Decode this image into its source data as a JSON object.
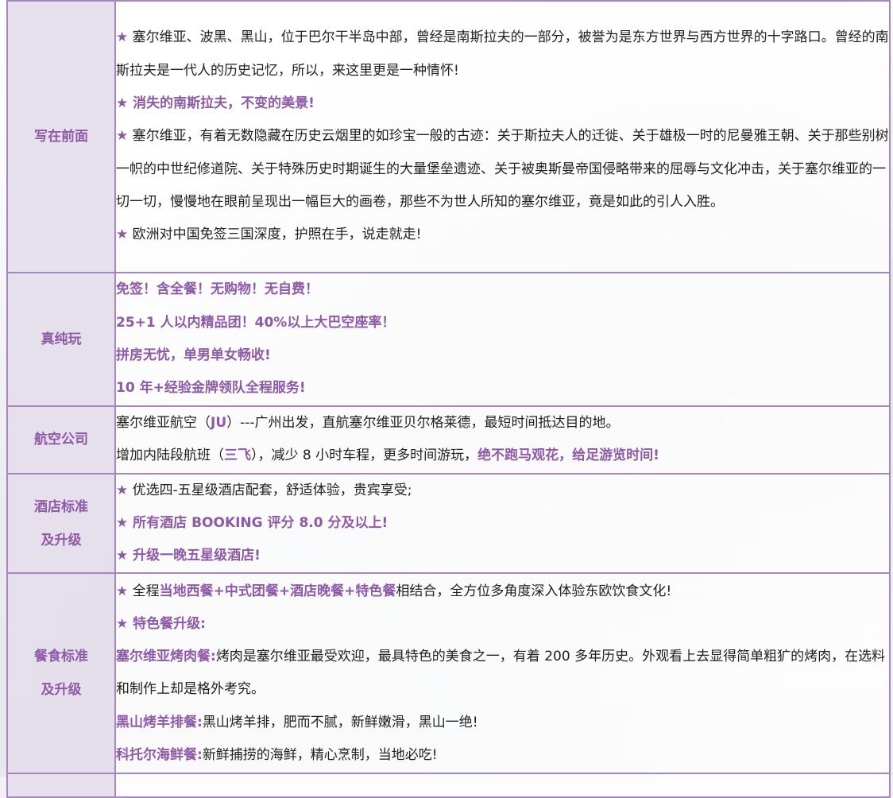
{
  "sections": [
    {
      "label": "写在前面",
      "p1_star": "★",
      "p1": "塞尔维亚、波黑、黑山，位于巴尔干半岛中部，曾经是南斯拉夫的一部分，被誉为是东方世界与西方世界的十字路口。曾经的南斯拉夫是一代人的历史记忆，所以，来这里更是一种情怀!",
      "p2": "★ 消失的南斯拉夫，不变的美景!",
      "p3_star": "★",
      "p3": "塞尔维亚，有着无数隐藏在历史云烟里的如珍宝一般的古迹：关于斯拉夫人的迁徙、关于雄极一时的尼曼雅王朝、关于那些别树一帜的中世纪修道院、关于特殊历史时期诞生的大量堡垒遗迹、关于被奥斯曼帝国侵略带来的屈辱与文化冲击，关于塞尔维亚的一切一切，慢慢地在眼前呈现出一幅巨大的画卷，那些不为世人所知的塞尔维亚，竟是如此的引人入胜。",
      "p4_star": "★",
      "p4": "欧洲对中国免签三国深度，护照在手，说走就走!"
    },
    {
      "label": "真纯玩",
      "lines": [
        "免签！含全餐！无购物！无自费！",
        "25+1 人以内精品团！40%以上大巴空座率！",
        "拼房无忧，单男单女畅收!",
        "10 年+经验金牌领队全程服务!"
      ]
    },
    {
      "label": "航空公司",
      "l1_a": "塞尔维亚航空（",
      "l1_b": "JU",
      "l1_c": "）---广州出发，直航塞尔维亚贝尔格莱德，最短时间抵达目的地。",
      "l2_a": "增加内陆段航班（",
      "l2_b": "三飞",
      "l2_c": "），减少 8 小时车程，更多时间游玩，",
      "l2_d": "绝不跑马观花，给足游览时间!"
    },
    {
      "label1": "酒店标准",
      "label2": "及升级",
      "l1_star": "★",
      "l1": "优选四-五星级酒店配套，舒适体验，贵宾享受;",
      "l2": "★ 所有酒店 BOOKING 评分 8.0 分及以上!",
      "l3": "★ 升级一晚五星级酒店!"
    },
    {
      "label1": "餐食标准",
      "label2": "及升级",
      "l1_star": "★",
      "l1_a": "全程",
      "l1_b": "当地西餐+中式团餐+酒店晚餐+特色餐",
      "l1_c": "相结合，全方位多角度深入体验东欧饮食文化!",
      "l2": "★ 特色餐升级:",
      "l3_a": "塞尔维亚烤肉餐:",
      "l3_b": "烤肉是塞尔维亚最受欢迎，最具特色的美食之一，有着 200 多年历史。外观看上去显得简单粗犷的烤肉，在选料和制作上却是格外考究。",
      "l4_a": "黑山烤羊排餐:",
      "l4_b": "黑山烤羊排，肥而不腻，新鲜嫩滑，黑山一绝!",
      "l5_a": "科托尔海鲜餐:",
      "l5_b": "新鲜捕捞的海鲜，精心烹制，当地必吃!"
    }
  ],
  "colors": {
    "accent": "#8e5aa8",
    "border": "#a587bd",
    "label_bg": "#e5deec"
  }
}
